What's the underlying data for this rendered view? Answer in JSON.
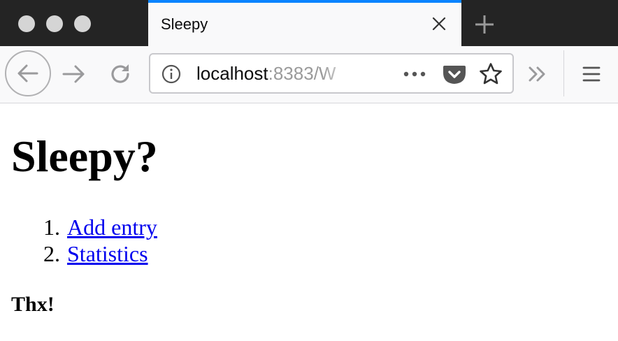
{
  "browser": {
    "tab": {
      "title": "Sleepy"
    },
    "url": {
      "host": "localhost",
      "rest": ":8383/W"
    },
    "colors": {
      "tab_accent": "#0a84ff",
      "titlebar": "#242424",
      "toolbar": "#f9f9fa",
      "link": "#0000ee"
    },
    "icons": {
      "close": "close-icon",
      "new_tab": "plus-icon",
      "back": "arrow-left-icon",
      "forward": "arrow-right-icon",
      "reload": "reload-icon",
      "info": "info-icon",
      "page_actions": "more-icon",
      "pocket": "pocket-icon",
      "bookmark": "star-icon",
      "overflow": "chevron-double-right-icon",
      "menu": "hamburger-menu-icon"
    }
  },
  "page": {
    "title": "Sleepy?",
    "nav": [
      {
        "number": "1.",
        "label": "Add entry"
      },
      {
        "number": "2.",
        "label": "Statistics"
      }
    ],
    "footer": "Thx!"
  }
}
